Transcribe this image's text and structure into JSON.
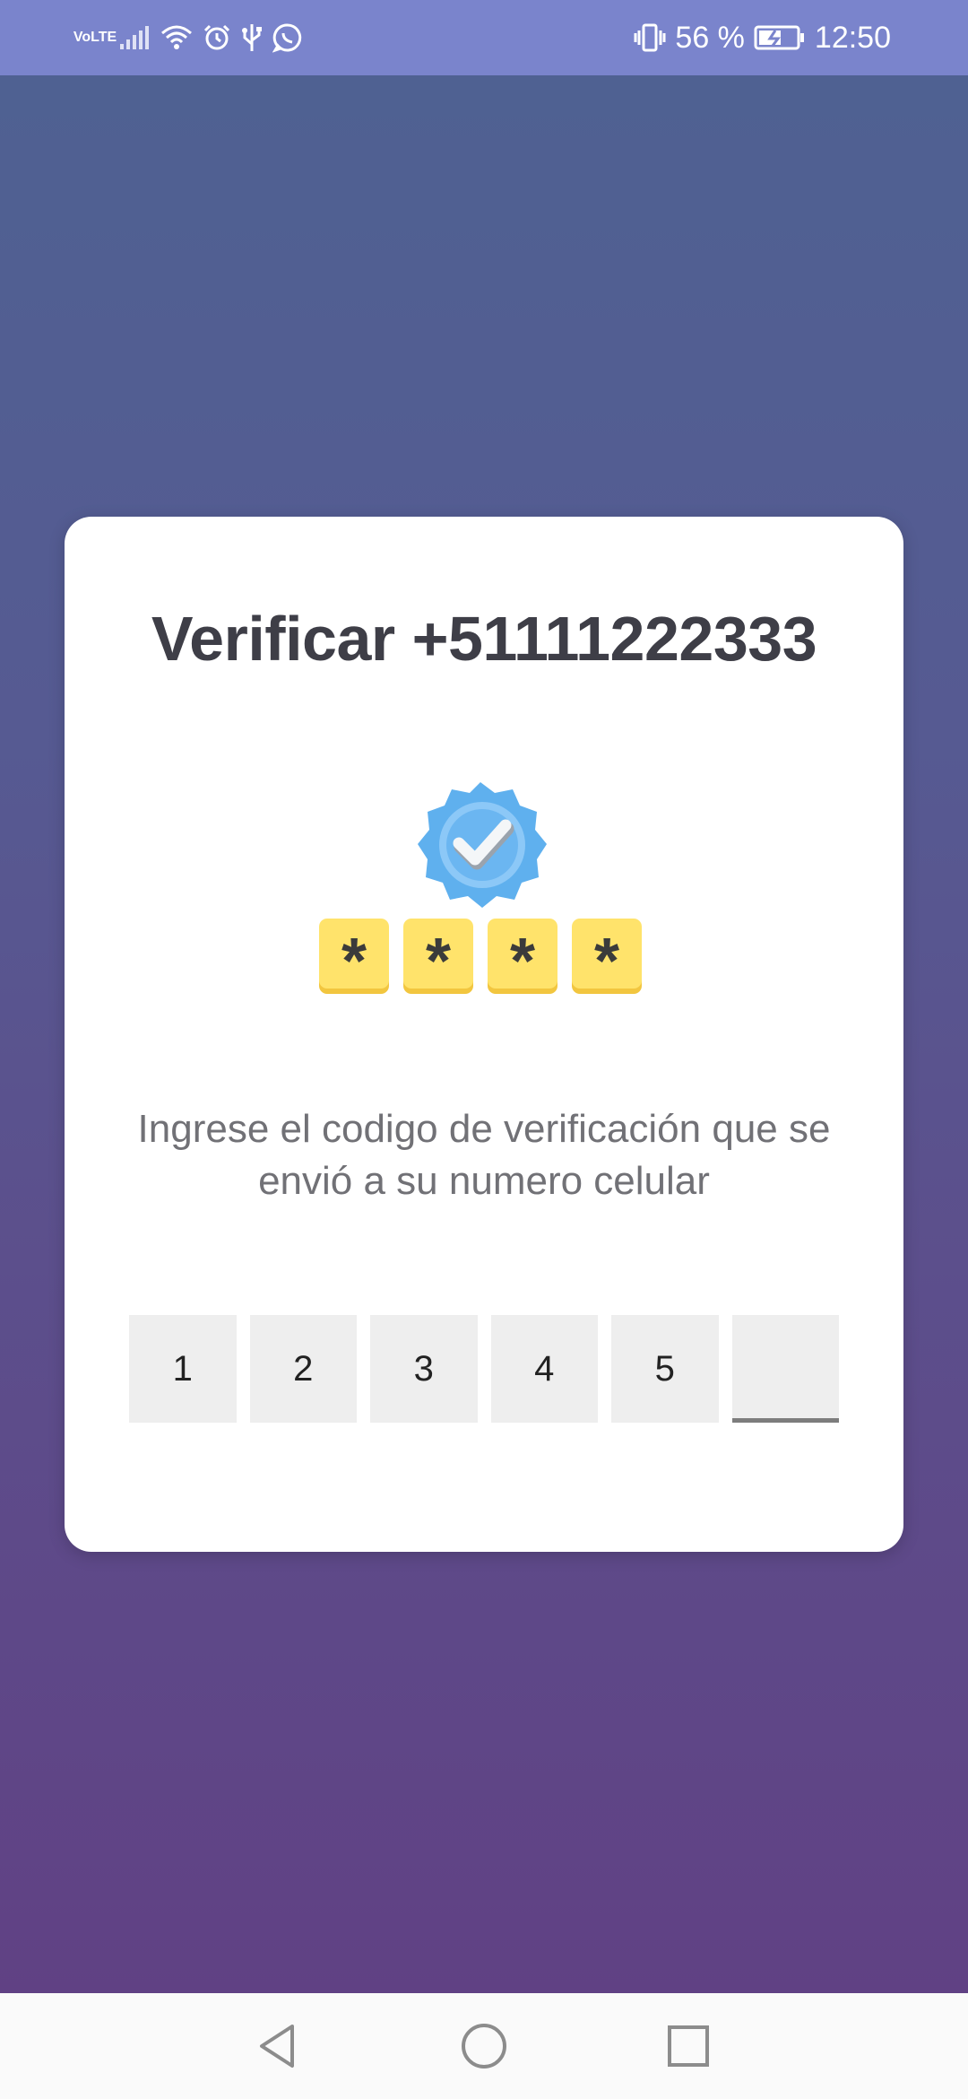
{
  "status_bar": {
    "left_icons": [
      "volte-icon",
      "signal-icon",
      "wifi-icon",
      "alarm-icon",
      "usb-icon",
      "whatsapp-icon"
    ],
    "volte_top": "Vo",
    "volte_bottom": "LTE",
    "battery_percent": "56 %",
    "time": "12:50"
  },
  "card": {
    "title": "Verificar +51111222333",
    "illustration": {
      "badge_icon": "verified-check-icon",
      "tiles": [
        "*",
        "*",
        "*",
        "*"
      ]
    },
    "instruction": "Ingrese el codigo de verificación que se envió a su numero celular",
    "code_digits": [
      "1",
      "2",
      "3",
      "4",
      "5",
      ""
    ]
  },
  "navigation": {
    "buttons": [
      "back-icon",
      "home-icon",
      "recents-icon"
    ]
  },
  "colors": {
    "status_bar": "#7a84cc",
    "title_text": "#3e3e47",
    "body_text": "#717176",
    "code_box": "#eeeeee",
    "tile_yellow": "#ffe36b",
    "badge_blue": "#5fb0ee"
  }
}
